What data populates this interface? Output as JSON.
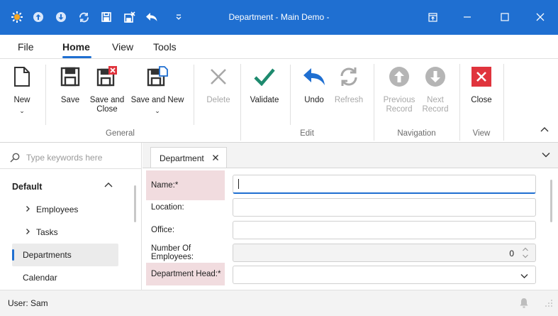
{
  "window": {
    "title": "Department - Main Demo -",
    "quick_access": [
      "app-icon",
      "upload-icon",
      "download-icon",
      "refresh-icon",
      "save-icon",
      "save-close-icon",
      "undo-icon",
      "customize-dropdown-icon"
    ]
  },
  "tabs": [
    {
      "label": "File",
      "active": false
    },
    {
      "label": "Home",
      "active": true
    },
    {
      "label": "View",
      "active": false
    },
    {
      "label": "Tools",
      "active": false
    }
  ],
  "ribbon": {
    "buttons": {
      "new": "New",
      "save": "Save",
      "save_close_1": "Save and",
      "save_close_2": "Close",
      "save_new": "Save and New",
      "delete": "Delete",
      "validate": "Validate",
      "undo": "Undo",
      "refresh": "Refresh",
      "prev_1": "Previous",
      "prev_2": "Record",
      "next_1": "Next",
      "next_2": "Record",
      "close": "Close"
    },
    "groups": {
      "general": "General",
      "edit": "Edit",
      "navigation": "Navigation",
      "view": "View"
    }
  },
  "sidebar": {
    "search_placeholder": "Type keywords here",
    "group": "Default",
    "items": [
      {
        "label": "Employees",
        "expandable": true
      },
      {
        "label": "Tasks",
        "expandable": true
      },
      {
        "label": "Departments",
        "selected": true
      },
      {
        "label": "Calendar"
      }
    ]
  },
  "document": {
    "tab_label": "Department",
    "fields": {
      "name_label": "Name:*",
      "name_value": "",
      "location_label": "Location:",
      "location_value": "",
      "office_label": "Office:",
      "office_value": "",
      "employees_label": "Number Of Employees:",
      "employees_value": "0",
      "head_label": "Department Head:*",
      "head_value": ""
    }
  },
  "status": {
    "user": "User: Sam"
  },
  "colors": {
    "accent": "#1f6fd1",
    "required_label_bg": "#f1dcdf",
    "validate_green": "#1e8a6e",
    "close_red": "#e0343d"
  }
}
